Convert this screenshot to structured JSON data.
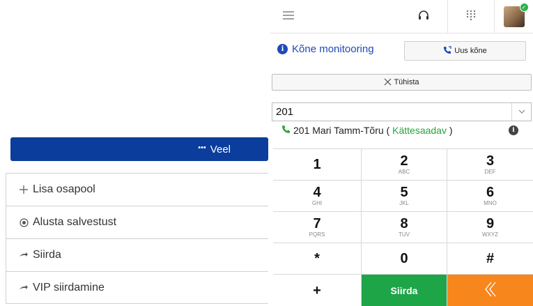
{
  "left_panel": {
    "more_button": {
      "dots": "•••",
      "label": "Veel"
    },
    "actions": [
      {
        "icon": "plus-icon",
        "label": "Lisa osapool"
      },
      {
        "icon": "record-icon",
        "label": "Alusta salvestust"
      },
      {
        "icon": "transfer-arrow-icon",
        "label": "Siirda"
      },
      {
        "icon": "transfer-arrow-icon",
        "label": "VIP siirdamine"
      }
    ]
  },
  "dialer": {
    "topbar": {
      "menu_icon": "hamburger-icon",
      "headset_icon": "headset-icon",
      "keypad_icon": "keypad-grid-icon",
      "avatar_status": "online"
    },
    "monitoring_label": "Kõne monitooring",
    "new_call_label": "Uus kõne",
    "cancel_label": "Tühista",
    "number_input": {
      "value": "201"
    },
    "contact": {
      "number": "201",
      "name": "Mari Tamm-Tõru",
      "status": "Kättesaadav"
    },
    "keys": [
      {
        "num": "1",
        "sub": ""
      },
      {
        "num": "2",
        "sub": "ABC"
      },
      {
        "num": "3",
        "sub": "DEF"
      },
      {
        "num": "4",
        "sub": "GHI"
      },
      {
        "num": "5",
        "sub": "JKL"
      },
      {
        "num": "6",
        "sub": "MNO"
      },
      {
        "num": "7",
        "sub": "PQRS"
      },
      {
        "num": "8",
        "sub": "TUV"
      },
      {
        "num": "9",
        "sub": "WXYZ"
      },
      {
        "num": "*",
        "sub": ""
      },
      {
        "num": "0",
        "sub": ""
      },
      {
        "num": "#",
        "sub": ""
      }
    ],
    "bottom_row": {
      "plus": "+",
      "transfer": "Siirda",
      "back_icon": "double-chevron-left-icon"
    },
    "colors": {
      "primary_blue": "#0b3d9c",
      "link_blue": "#1f49b6",
      "green": "#1ea548",
      "orange": "#f7861d"
    }
  }
}
